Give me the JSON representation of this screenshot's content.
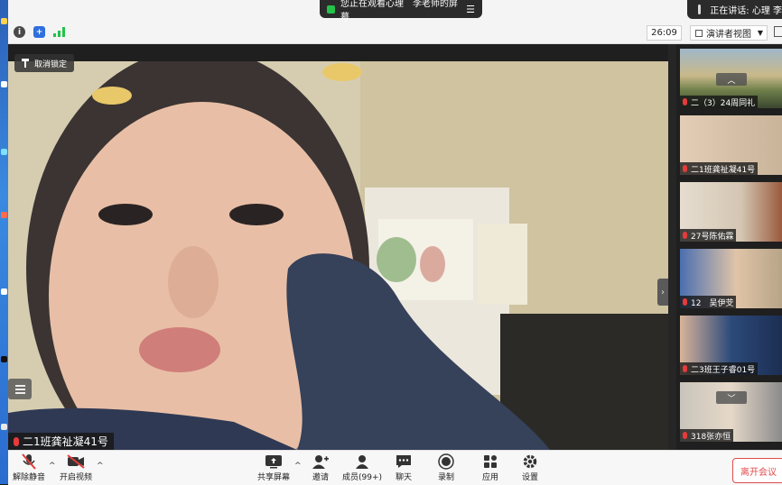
{
  "top": {
    "share_banner": "您正在观看心理　李老师的屏幕",
    "banner_menu_icon": "list-icon",
    "speaking_label": "正在讲话: 心理 李"
  },
  "status": {
    "timer": "26:09",
    "view_label": "演讲者视图"
  },
  "main": {
    "unpin_label": "取消锁定",
    "speaker_name": "二1班龚祉凝41号"
  },
  "gallery": {
    "tiles": [
      {
        "name": "二（3）24周同礼"
      },
      {
        "name": "二1班龚祉凝41号"
      },
      {
        "name": "27号陈佑霖"
      },
      {
        "name": "12　吴伊芠"
      },
      {
        "name": "二3班王子睿01号"
      },
      {
        "name": "318张亦恒"
      }
    ]
  },
  "toolbar": {
    "unmute": "解除静音",
    "start_video": "开启视频",
    "share_screen": "共享屏幕",
    "invite": "邀请",
    "participants": "成员(99+)",
    "chat": "聊天",
    "record": "录制",
    "apps": "应用",
    "settings": "设置",
    "leave": "离开会议"
  },
  "colors": {
    "accent_green": "#23c24a",
    "danger_red": "#e04b4b",
    "muted_mic_red": "#e53b3b"
  }
}
